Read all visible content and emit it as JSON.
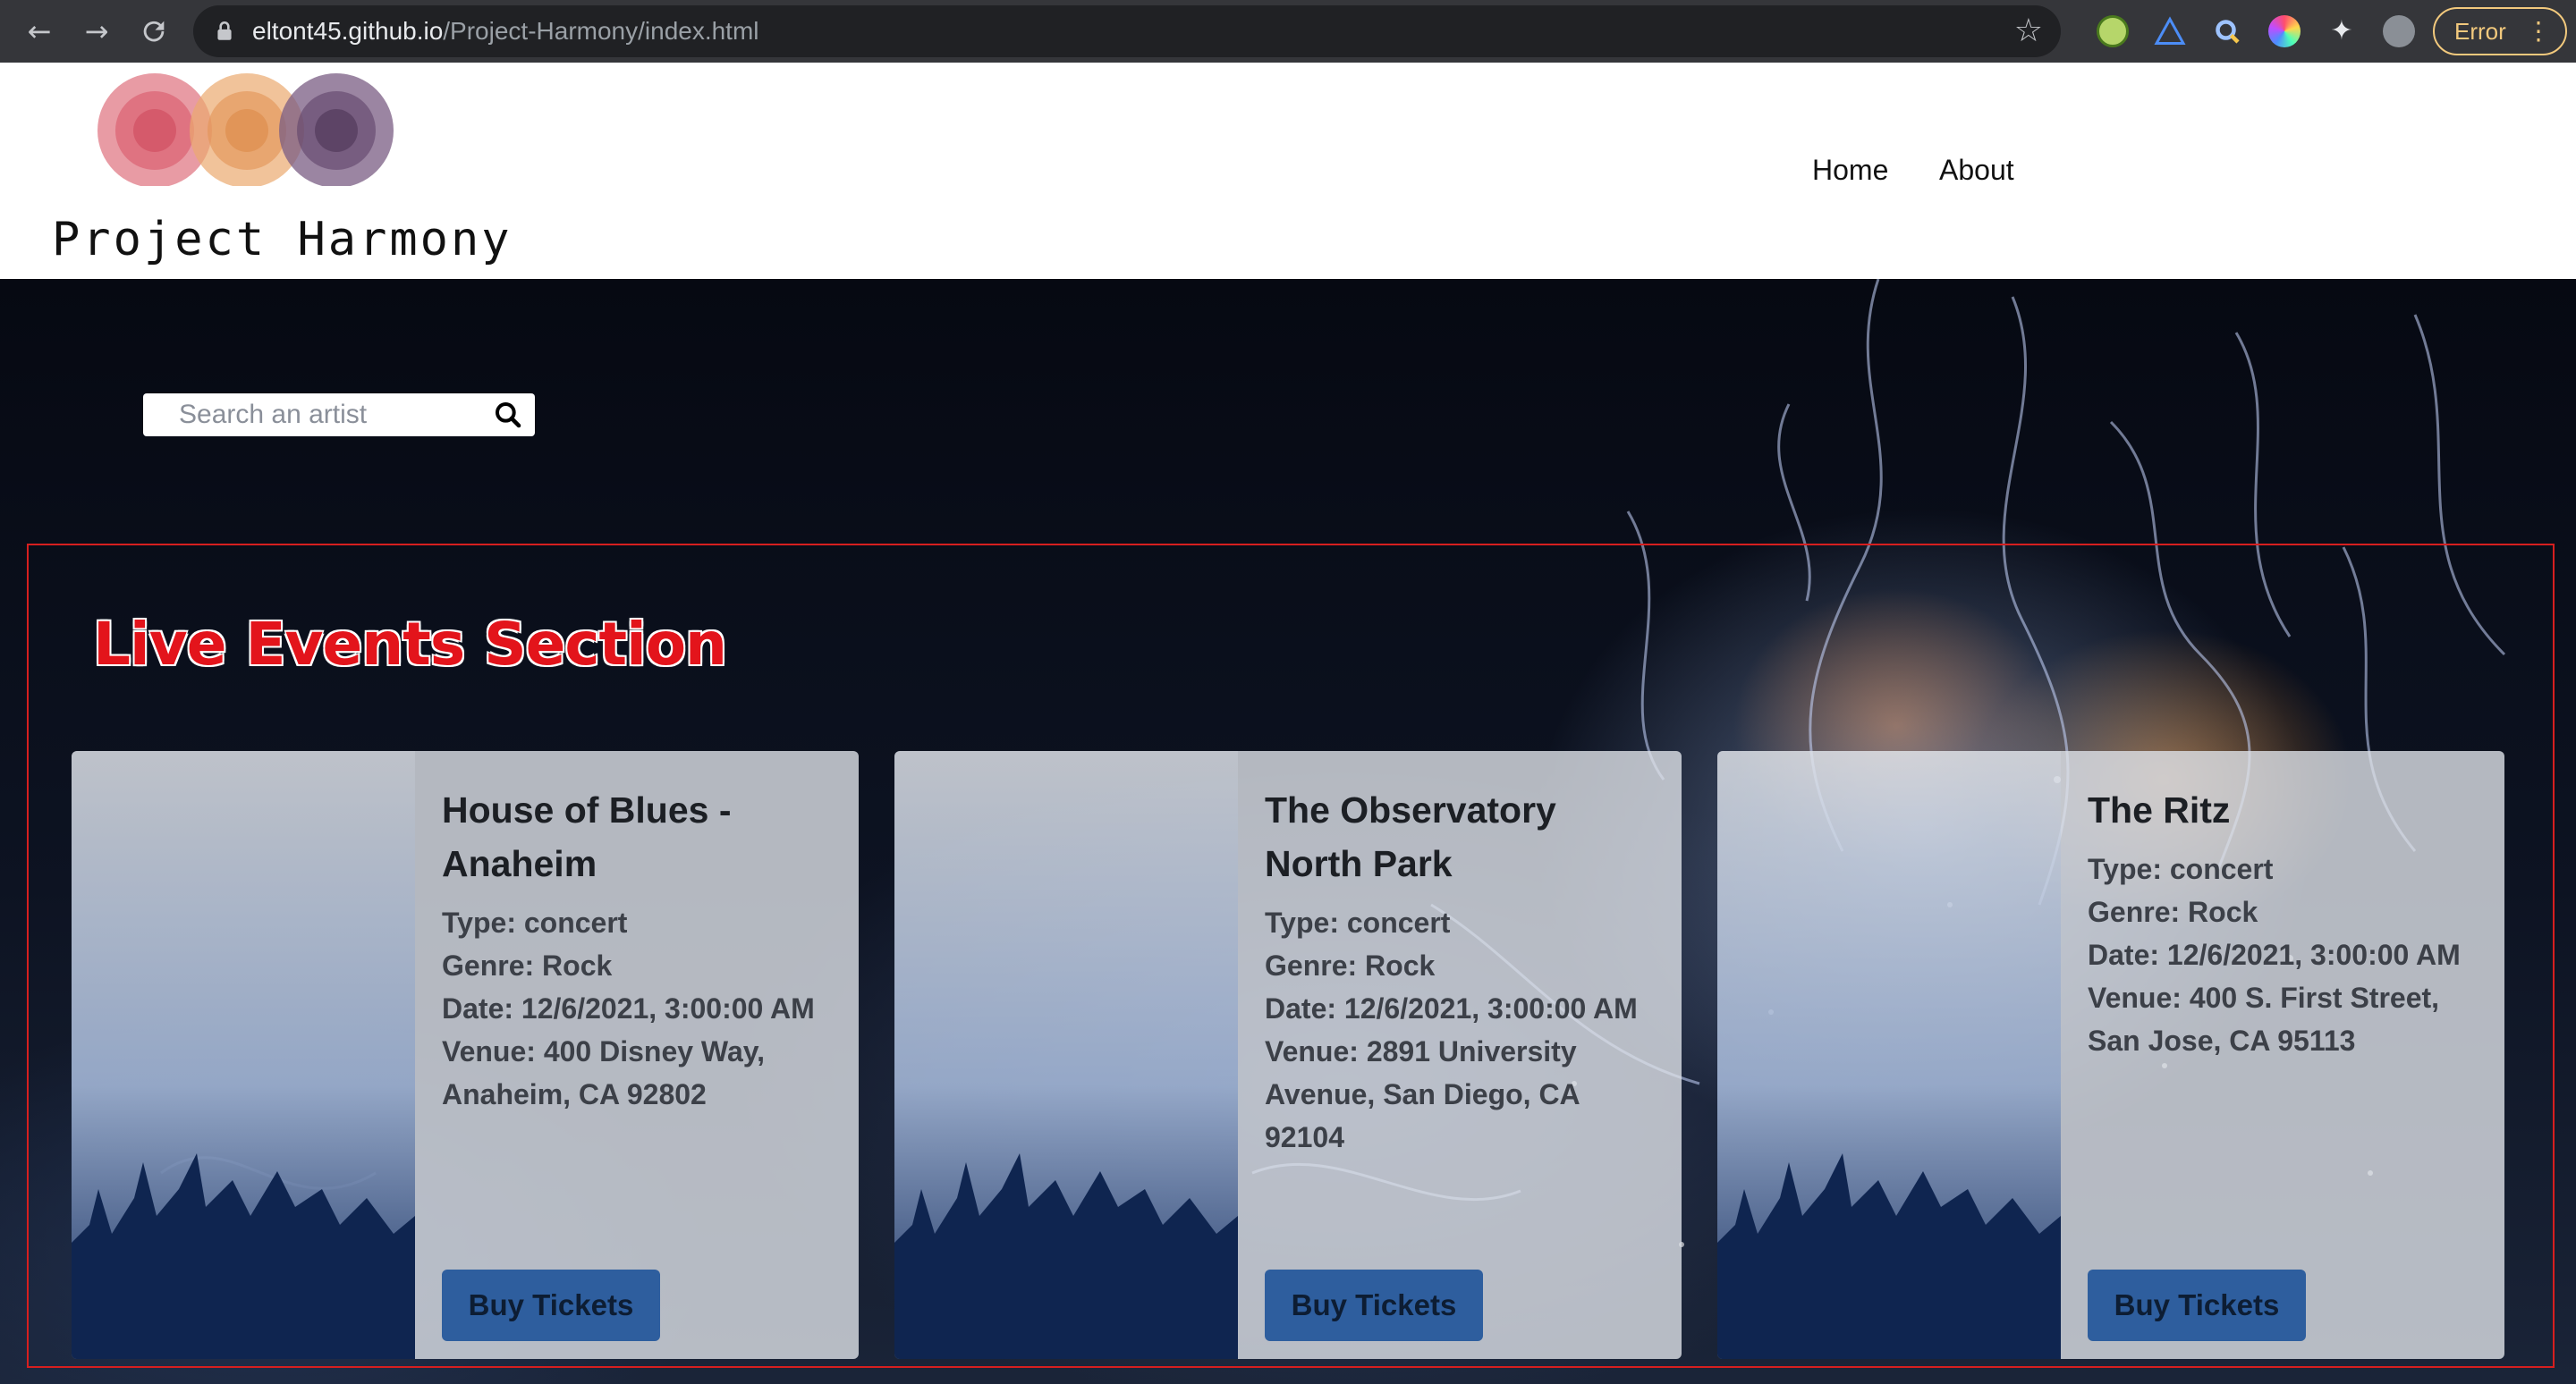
{
  "browser": {
    "url_host": "eltont45.github.io",
    "url_path": "/Project-Harmony/index.html",
    "back_icon": "arrow-left-icon",
    "forward_icon": "arrow-right-icon",
    "reload_icon": "reload-icon",
    "error_label": "Error"
  },
  "header": {
    "logo_text": "Project Harmony",
    "logo_colors": [
      "#e07a86",
      "#eba96f",
      "#7a5c83"
    ],
    "nav": [
      {
        "label": "Home"
      },
      {
        "label": "About"
      }
    ]
  },
  "search": {
    "placeholder": "Search an artist",
    "value": ""
  },
  "events": {
    "section_title": "Live Events Section",
    "buy_label": "Buy Tickets",
    "cards": [
      {
        "name": "House of Blues - Anaheim",
        "type": "Type: concert",
        "genre": "Genre: Rock",
        "date": "Date: 12/6/2021, 3:00:00 AM",
        "venue": "Venue: 400 Disney Way, Anaheim, CA 92802"
      },
      {
        "name": "The Observatory North Park",
        "type": "Type: concert",
        "genre": "Genre: Rock",
        "date": "Date: 12/6/2021, 3:00:00 AM",
        "venue": "Venue: 2891 University Avenue, San Diego, CA 92104"
      },
      {
        "name": "The Ritz",
        "type": "Type: concert",
        "genre": "Genre: Rock",
        "date": "Date: 12/6/2021, 3:00:00 AM",
        "venue": "Venue: 400 S. First Street, San Jose, CA 95113"
      }
    ]
  },
  "colors": {
    "accent_button": "#2e5e9e",
    "section_title": "#e3141b",
    "frame_border": "#d61f1f"
  }
}
